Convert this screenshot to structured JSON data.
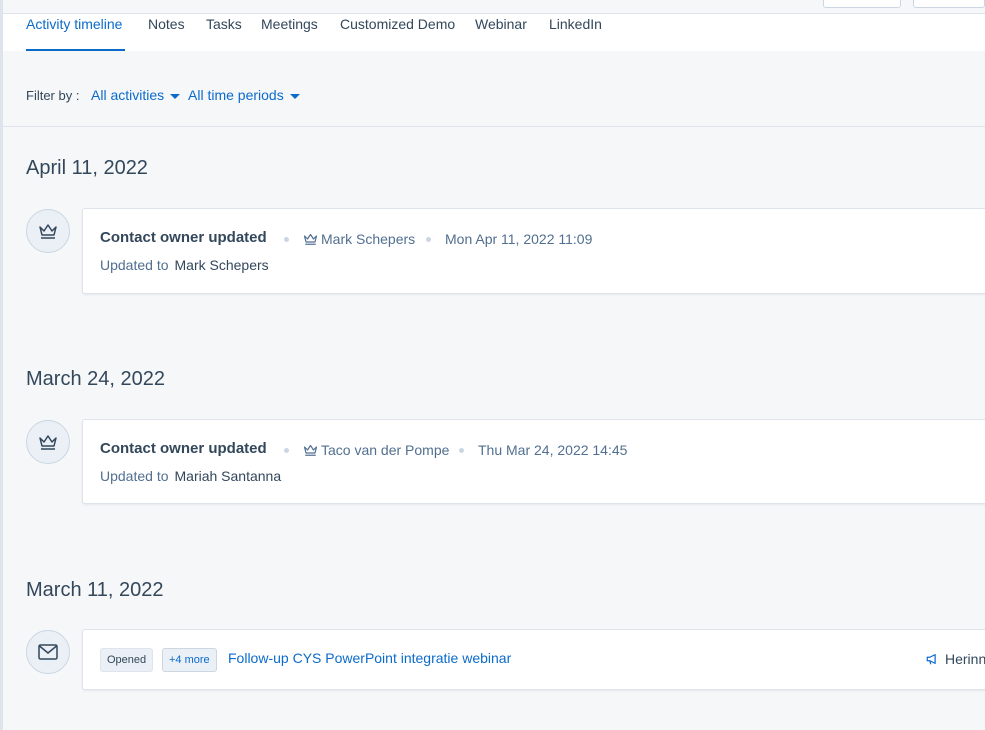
{
  "tabs": [
    {
      "label": "Activity timeline",
      "active": true
    },
    {
      "label": "Notes"
    },
    {
      "label": "Tasks"
    },
    {
      "label": "Meetings"
    },
    {
      "label": "Customized Demo"
    },
    {
      "label": "Webinar"
    },
    {
      "label": "LinkedIn"
    }
  ],
  "filter": {
    "label": "Filter by :",
    "activities": "All activities",
    "periods": "All time periods"
  },
  "groups": [
    {
      "date": "April 11, 2022",
      "icon": "crown-icon",
      "title": "Contact owner updated",
      "user": "Mark Schepers",
      "timestamp": "Mon Apr 11, 2022 11:09",
      "sub_label": "Updated to",
      "sub_value": "Mark Schepers"
    },
    {
      "date": "March 24, 2022",
      "icon": "crown-icon",
      "title": "Contact owner updated",
      "user": "Taco van der Pompe",
      "timestamp": "Thu Mar 24, 2022 14:45",
      "sub_label": "Updated to",
      "sub_value": "Mariah Santanna"
    },
    {
      "date": "March 11, 2022",
      "icon": "envelope-icon",
      "badge_opened": "Opened",
      "badge_more": "+4 more",
      "email_subject": "Follow-up CYS PowerPoint integratie webinar",
      "campaign_label": "Herinn"
    }
  ],
  "colors": {
    "accent": "#0b6bcb",
    "text": "#33475b",
    "muted": "#516f90",
    "background": "#f5f7f9"
  }
}
